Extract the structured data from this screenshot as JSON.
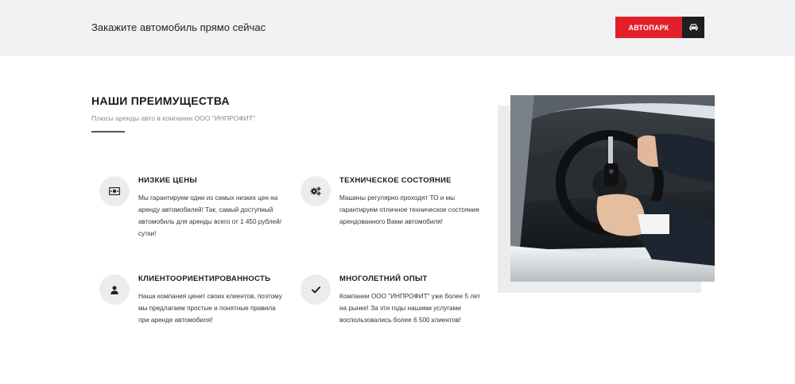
{
  "topbar": {
    "text": "Закажите автомобиль прямо сейчас",
    "button_label": "АВТОПАРК",
    "button_icon": "car-icon",
    "accent_color": "#e3202a"
  },
  "section": {
    "title": "НАШИ ПРЕИМУЩЕСТВА",
    "subtitle": "Плюсы аренды авто в компании ООО \"ИНПРОФИТ\""
  },
  "features": [
    {
      "icon": "money-icon",
      "title": "НИЗКИЕ ЦЕНЫ",
      "text": "Мы гарантируем одни из самых низких цен на аренду автомобилей! Так, самый доступный автомобиль для аренды всего от 1 450 рублей/сутки!"
    },
    {
      "icon": "gears-icon",
      "title": "ТЕХНИЧЕСКОЕ СОСТОЯНИЕ",
      "text": "Машины регулярно проходят ТО и мы гарантируем отличное техническое состояние арендованного Вами автомобиля!"
    },
    {
      "icon": "user-icon",
      "title": "КЛИЕНТООРИЕНТИРОВАННОСТЬ",
      "text": "Наша компания ценит своих клиентов, поэтому мы предлагаем простые и понятные правила при аренде автомобиля!"
    },
    {
      "icon": "check-icon",
      "title": "МНОГОЛЕТНИЙ ОПЫТ",
      "text": "Компании ООО \"ИНПРОФИТ\" уже более 5 лет на рынке! За эти годы нашими услугами воспользовались более 6 500 клиентов!"
    }
  ]
}
